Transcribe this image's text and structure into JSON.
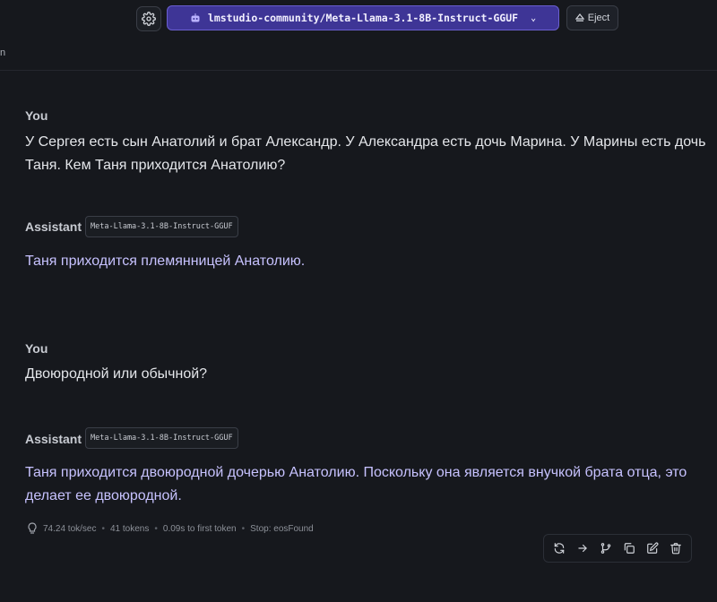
{
  "header": {
    "model_name": "lmstudio-community/Meta-Llama-3.1-8B-Instruct-GGUF",
    "eject_label": "Eject",
    "tab_fragment": "n"
  },
  "messages": [
    {
      "author": "You",
      "text": "У Сергея есть сын Анатолий и брат Александр. У Александра есть дочь Марина. У Марины есть дочь Таня. Кем Таня приходится Анатолию?"
    },
    {
      "author": "Assistant",
      "model_chip": "Meta-Llama-3.1-8B-Instruct-GGUF",
      "text": "Таня приходится племянницей Анатолию."
    },
    {
      "author": "You",
      "text": "Двоюродной или обычной?"
    },
    {
      "author": "Assistant",
      "model_chip": "Meta-Llama-3.1-8B-Instruct-GGUF",
      "text": "Таня приходится двоюродной дочерью Анатолию. Поскольку она является внучкой брата отца, это делает ее двоюродной."
    }
  ],
  "stats": {
    "speed": "74.24 tok/sec",
    "tokens": "41 tokens",
    "first_token": "0.09s to first token",
    "stop": "Stop: eosFound"
  },
  "icons": {
    "settings": "gear-icon",
    "model": "robot-icon",
    "eject": "eject-icon",
    "stats": "lightbulb-icon",
    "actions": [
      "regenerate-icon",
      "continue-arrow-icon",
      "branch-icon",
      "copy-icon",
      "edit-icon",
      "delete-icon"
    ]
  },
  "colors": {
    "background": "#16181d",
    "model_button": "#3e3596",
    "assistant_text": "#c7c2ff"
  }
}
